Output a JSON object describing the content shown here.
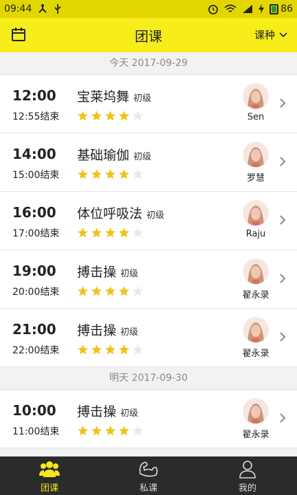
{
  "status": {
    "time": "09:44",
    "battery": "86"
  },
  "header": {
    "title": "团课",
    "course_type_label": "课种"
  },
  "sections": [
    {
      "date": "今天 2017-09-29",
      "classes": [
        {
          "start": "12:00",
          "end": "12:55结束",
          "name": "宝莱坞舞",
          "level": "初级",
          "rating": 4,
          "coach": "Sen"
        },
        {
          "start": "14:00",
          "end": "15:00结束",
          "name": "基础瑜伽",
          "level": "初级",
          "rating": 4,
          "coach": "罗慧"
        },
        {
          "start": "16:00",
          "end": "17:00结束",
          "name": "体位呼吸法",
          "level": "初级",
          "rating": 4,
          "coach": "Raju"
        },
        {
          "start": "19:00",
          "end": "20:00结束",
          "name": "搏击操",
          "level": "初级",
          "rating": 4,
          "coach": "翟永录"
        },
        {
          "start": "21:00",
          "end": "22:00结束",
          "name": "搏击操",
          "level": "初级",
          "rating": 4,
          "coach": "翟永录"
        }
      ]
    },
    {
      "date": "明天 2017-09-30",
      "classes": [
        {
          "start": "10:00",
          "end": "11:00结束",
          "name": "搏击操",
          "level": "初级",
          "rating": 4,
          "coach": "翟永录"
        }
      ]
    }
  ],
  "tabs": [
    {
      "label": "团课",
      "icon": "group-icon",
      "active": true
    },
    {
      "label": "私课",
      "icon": "muscle-icon",
      "active": false
    },
    {
      "label": "我的",
      "icon": "person-icon",
      "active": false
    }
  ],
  "colors": {
    "accent": "#f6ed1a",
    "star": "#f2c21a",
    "tabbar": "#2b2b2b"
  }
}
